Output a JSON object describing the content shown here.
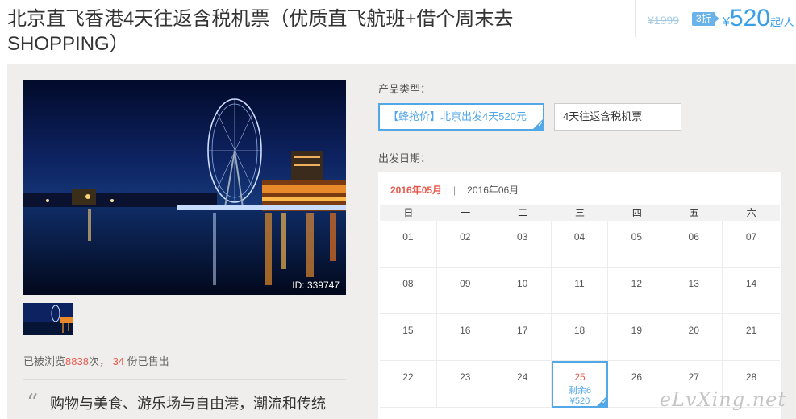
{
  "header": {
    "title": "北京直飞香港4天往返含税机票（优质直飞航班+借个周末去SHOPPING）",
    "original_price": "¥1999",
    "discount": "3折",
    "price_currency": "¥",
    "price_value": "520",
    "price_unit": "起/人"
  },
  "gallery": {
    "photo_id": "ID: 339747"
  },
  "stats": {
    "views_prefix": "已被浏览",
    "views_count": "8838",
    "views_suffix": "次，",
    "sold_count": "34",
    "sold_suffix": "份已售出"
  },
  "description": {
    "quote_icon": "“",
    "text": "购物与美食、游乐场与自由港，潮流和传统"
  },
  "product": {
    "type_label": "产品类型：",
    "options": [
      {
        "label": "【蜂抢价】北京出发4天520元",
        "selected": true
      },
      {
        "label": "4天往返含税机票",
        "selected": false
      }
    ],
    "date_label": "出发日期："
  },
  "calendar": {
    "months": [
      "2016年05月",
      "2016年06月"
    ],
    "active_month": 0,
    "weekdays": [
      "日",
      "一",
      "二",
      "三",
      "四",
      "五",
      "六"
    ],
    "days": [
      {
        "d": "01"
      },
      {
        "d": "02"
      },
      {
        "d": "03"
      },
      {
        "d": "04"
      },
      {
        "d": "05"
      },
      {
        "d": "06"
      },
      {
        "d": "07"
      },
      {
        "d": "08"
      },
      {
        "d": "09"
      },
      {
        "d": "10"
      },
      {
        "d": "11"
      },
      {
        "d": "12"
      },
      {
        "d": "13"
      },
      {
        "d": "14"
      },
      {
        "d": "15"
      },
      {
        "d": "16"
      },
      {
        "d": "17"
      },
      {
        "d": "18"
      },
      {
        "d": "19"
      },
      {
        "d": "20"
      },
      {
        "d": "21"
      },
      {
        "d": "22"
      },
      {
        "d": "23"
      },
      {
        "d": "24"
      },
      {
        "d": "25",
        "remain": "剩余6",
        "price": "¥520",
        "selected": true
      },
      {
        "d": "26"
      },
      {
        "d": "27"
      },
      {
        "d": "28"
      }
    ]
  },
  "watermark": "eLvXing.net",
  "colors": {
    "accent_blue": "#52a7e6",
    "price_blue": "#39a0e8",
    "accent_red": "#e8584a",
    "panel_bg": "#efeeec"
  }
}
